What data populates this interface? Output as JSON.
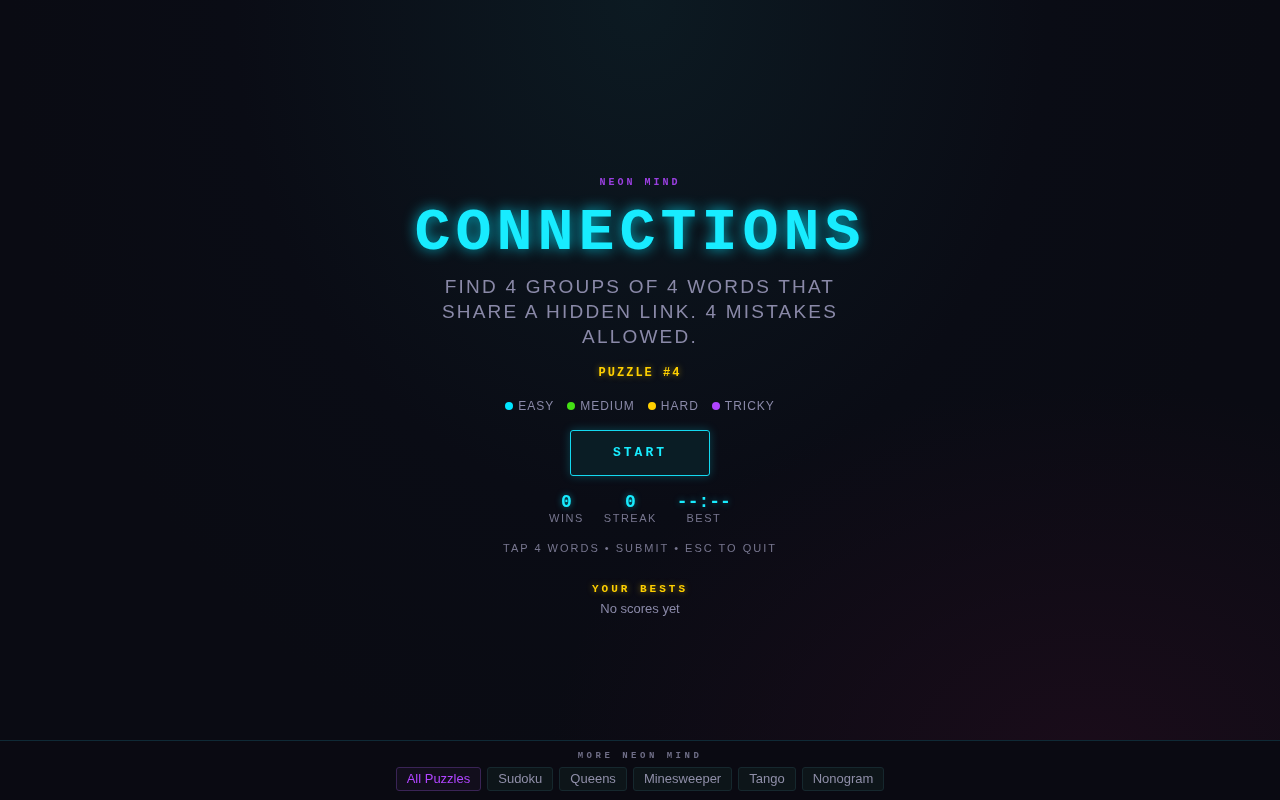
{
  "brand": "NEON MIND",
  "title": "CONNECTIONS",
  "subtitle": "FIND 4 GROUPS OF 4 WORDS THAT SHARE A HIDDEN LINK. 4 MISTAKES ALLOWED.",
  "puzzle_label": "PUZZLE #4",
  "legend": [
    {
      "label": "EASY",
      "color": "#00e5ff"
    },
    {
      "label": "MEDIUM",
      "color": "#44e014"
    },
    {
      "label": "HARD",
      "color": "#ffd000"
    },
    {
      "label": "TRICKY",
      "color": "#b044ff"
    }
  ],
  "start_button": "START",
  "stats": [
    {
      "value": "0",
      "label": "WINS"
    },
    {
      "value": "0",
      "label": "STREAK"
    },
    {
      "value": "--:--",
      "label": "BEST"
    }
  ],
  "hint": "TAP 4 WORDS • SUBMIT • ESC TO QUIT",
  "bests": {
    "title": "YOUR BESTS",
    "empty_text": "No scores yet"
  },
  "footer": {
    "title": "MORE NEON MIND",
    "links": [
      {
        "label": "All Puzzles",
        "selected": true
      },
      {
        "label": "Sudoku",
        "selected": false
      },
      {
        "label": "Queens",
        "selected": false
      },
      {
        "label": "Minesweeper",
        "selected": false
      },
      {
        "label": "Tango",
        "selected": false
      },
      {
        "label": "Nonogram",
        "selected": false
      }
    ]
  }
}
